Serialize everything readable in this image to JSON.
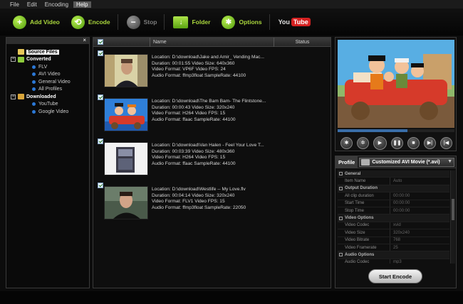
{
  "menu": [
    "File",
    "Edit",
    "Encoding",
    "Help"
  ],
  "toolbar": {
    "add_video": "Add Video",
    "encode": "Encode",
    "stop": "Stop",
    "folder": "Folder",
    "options": "Options",
    "youtube_you": "You",
    "youtube_tube": "Tube"
  },
  "tree": {
    "close": "×",
    "source_files": "Source Files",
    "converted": "Converted",
    "converted_items": [
      "FLV",
      "AVI Video",
      "General Video",
      "All Profiles"
    ],
    "downloaded": "Downloaded",
    "downloaded_items": [
      "YouTube",
      "Google Video"
    ]
  },
  "list": {
    "col_name": "Name",
    "col_status": "Status",
    "files": [
      {
        "location": "Location: D:\\download\\Jake and Amir_ Vending Mac...",
        "duration": "Duration: 00:01:55    Video Size: 640x360",
        "vformat": "Video Format: VP6F    Video FPS: 24",
        "aformat": "Audio Format: ffmp3float    SampleRate: 44100"
      },
      {
        "location": "Location: D:\\download\\The Bam Bam- The Flintstone...",
        "duration": "Duration: 00:00:43    Video Size: 320x240",
        "vformat": "Video Format: H264    Video FPS: 15",
        "aformat": "Audio Format: ffaac    SampleRate: 44100"
      },
      {
        "location": "Location: D:\\download\\Van Halen - Feel Your Love T...",
        "duration": "Duration: 00:03:39    Video Size: 480x360",
        "vformat": "Video Format: H264    Video FPS: 15",
        "aformat": "Audio Format: ffaac    SampleRate: 44100"
      },
      {
        "location": "Location: D:\\download\\Westlife -- My Love.flv",
        "duration": "Duration: 00:04:14    Video Size: 320x240",
        "vformat": "Video Format: FLV1    Video FPS: 15",
        "aformat": "Audio Format: ffmp3float    SampleRate: 22050"
      }
    ]
  },
  "preview": {
    "seek_fraction": 0.6
  },
  "profile": {
    "tab": "Profile",
    "selected": "Customized AVI Movie (*.avi)",
    "props": [
      {
        "type": "cat",
        "label": "General"
      },
      {
        "type": "row",
        "key": "Item Name",
        "value": "Auto"
      },
      {
        "type": "cat",
        "label": "Output Duration"
      },
      {
        "type": "row",
        "key": "All clip duration",
        "value": "00:00:00"
      },
      {
        "type": "row",
        "key": "Start Time",
        "value": "00:00:00"
      },
      {
        "type": "row",
        "key": "Stop Time",
        "value": "00:00:00"
      },
      {
        "type": "cat",
        "label": "Video Options"
      },
      {
        "type": "row",
        "key": "Video Codec",
        "value": "xvid"
      },
      {
        "type": "row",
        "key": "Video Size",
        "value": "320x240"
      },
      {
        "type": "row",
        "key": "Video Bitrate",
        "value": "768"
      },
      {
        "type": "row",
        "key": "Video Framerate",
        "value": "25"
      },
      {
        "type": "cat",
        "label": "Audio Options"
      },
      {
        "type": "row",
        "key": "Audio Codec",
        "value": "mp3"
      }
    ],
    "start_encode": "Start Encode"
  }
}
